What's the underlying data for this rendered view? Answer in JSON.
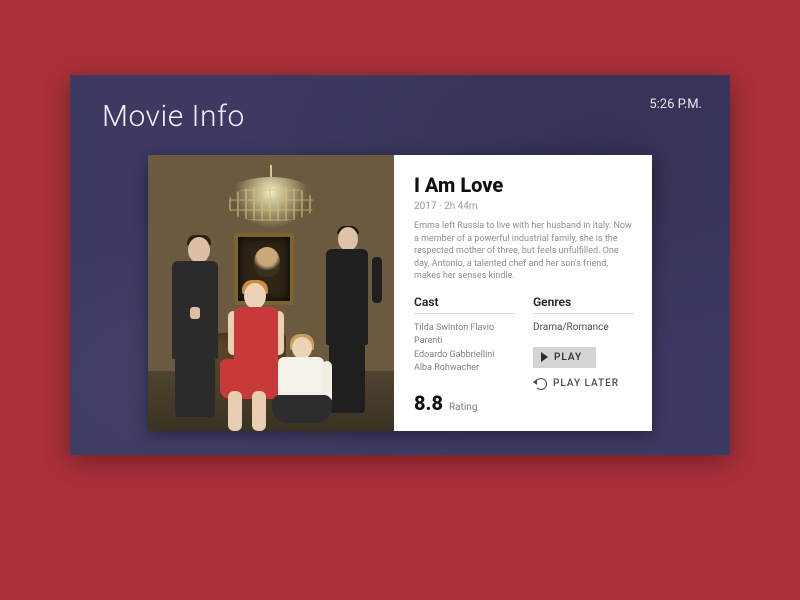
{
  "page_title": "Movie Info",
  "clock": "5:26 P.M.",
  "movie": {
    "title": "I Am Love",
    "year": "2017",
    "runtime": "2h 44m",
    "meta_separator": " · ",
    "synopsis": "Emma left Russia to live with her husband in Italy. Now a member of a powerful industrial family, she is the respected mother of three, but feels unfulfilled. One day, Antonio, a talented chef and her son's friend, makes her senses kindle.",
    "cast_heading": "Cast",
    "cast": [
      "Tilda Swinton Flavio",
      "Parenti",
      "Edoardo Gabbriellini",
      "Alba Rohwacher"
    ],
    "genres_heading": "Genres",
    "genres": "Drama/Romance",
    "rating": {
      "value": "8.8",
      "label": "Rating"
    }
  },
  "actions": {
    "play": "PLAY",
    "play_later": "PLAY LATER"
  },
  "poster": {
    "description": "Four people posed in an ornate interior: two men in dark suits standing at the sides, a woman in a red dress seated on a chair in the center, and a young woman in a white blouse and dark skirt seated on the floor. A crystal chandelier hangs above and a framed portrait is on the back wall."
  }
}
